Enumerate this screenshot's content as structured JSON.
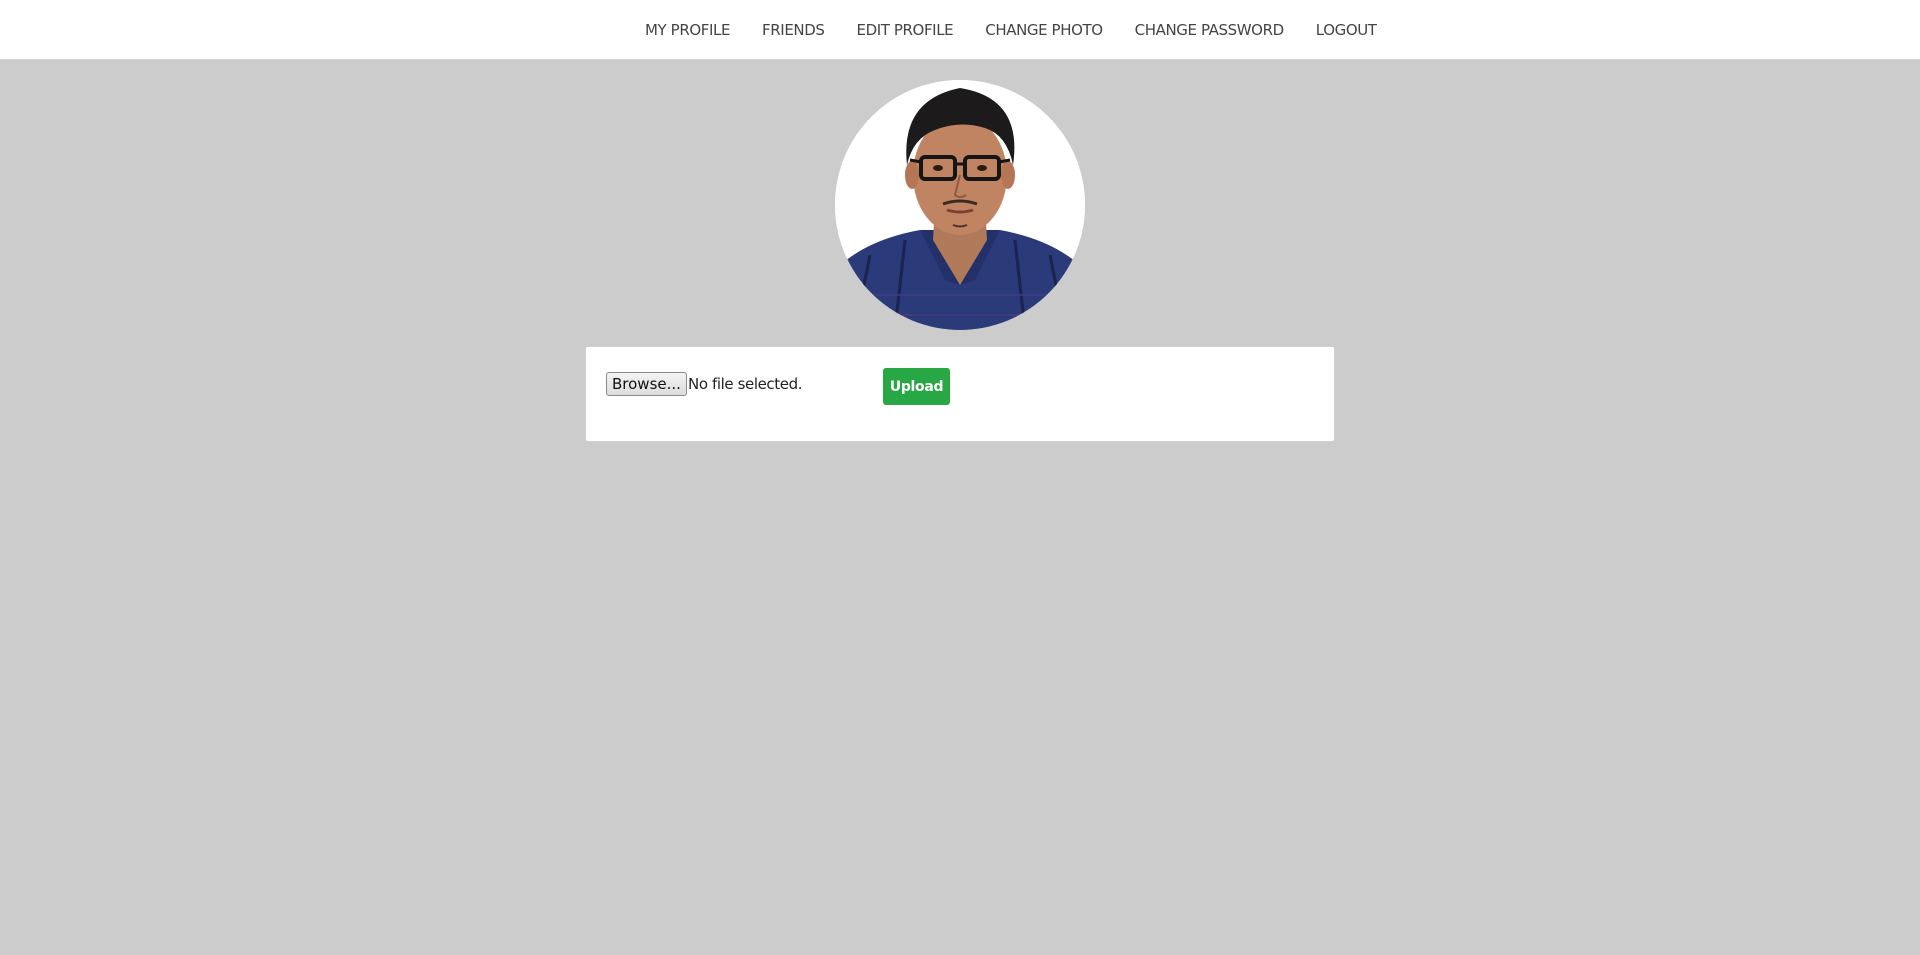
{
  "nav": {
    "items": [
      {
        "label": "MY PROFILE"
      },
      {
        "label": "FRIENDS"
      },
      {
        "label": "EDIT PROFILE"
      },
      {
        "label": "CHANGE PHOTO"
      },
      {
        "label": "CHANGE PASSWORD"
      },
      {
        "label": "LOGOUT"
      }
    ]
  },
  "upload": {
    "browse_label": "Browse...",
    "file_status": "No file selected.",
    "upload_label": "Upload"
  },
  "colors": {
    "page_background": "#cccccc",
    "upload_button": "#28a745"
  }
}
